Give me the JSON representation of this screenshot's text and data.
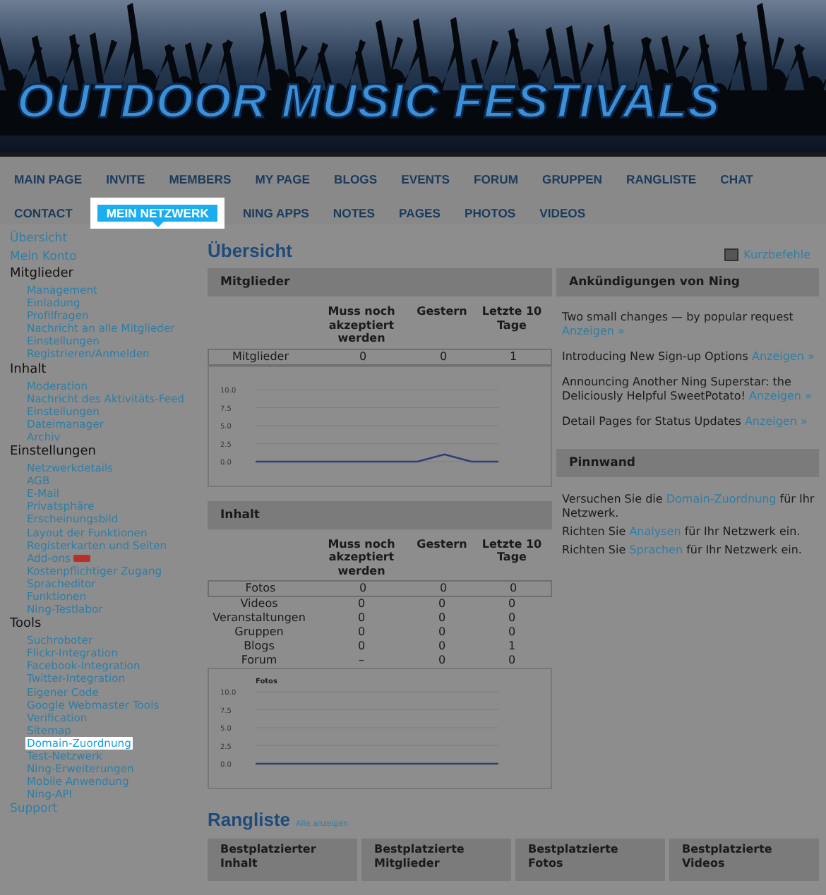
{
  "banner": {
    "title": "OUTDOOR MUSIC FESTIVALS"
  },
  "nav": {
    "tabs": [
      {
        "label": "MAIN PAGE",
        "selected": false
      },
      {
        "label": "INVITE",
        "selected": false
      },
      {
        "label": "MEMBERS",
        "selected": false
      },
      {
        "label": "MY PAGE",
        "selected": false
      },
      {
        "label": "BLOGS",
        "selected": false
      },
      {
        "label": "EVENTS",
        "selected": false
      },
      {
        "label": "FORUM",
        "selected": false
      },
      {
        "label": "GRUPPEN",
        "selected": false
      },
      {
        "label": "RANGLISTE",
        "selected": false
      },
      {
        "label": "CHAT",
        "selected": false
      },
      {
        "label": "CONTACT",
        "selected": false
      },
      {
        "label": "MEIN NETZWERK",
        "selected": true
      },
      {
        "label": "NING APPS",
        "selected": false
      },
      {
        "label": "NOTES",
        "selected": false
      },
      {
        "label": "PAGES",
        "selected": false
      },
      {
        "label": "PHOTOS",
        "selected": false
      },
      {
        "label": "VIDEOS",
        "selected": false
      }
    ]
  },
  "sidebar": {
    "items": [
      {
        "kind": "link",
        "label": "Übersicht"
      },
      {
        "kind": "link",
        "label": "Mein Konto"
      },
      {
        "kind": "section",
        "label": "Mitglieder",
        "children": [
          {
            "label": "Management",
            "selected": false,
            "new": false
          },
          {
            "label": "Einladung",
            "selected": false,
            "new": false
          },
          {
            "label": "Profilfragen",
            "selected": false,
            "new": false
          },
          {
            "label": "Nachricht an alle Mitglieder",
            "selected": false,
            "new": false
          },
          {
            "label": "Einstellungen",
            "selected": false,
            "new": false
          },
          {
            "label": "Registrieren/Anmelden",
            "selected": false,
            "new": false
          }
        ]
      },
      {
        "kind": "section",
        "label": "Inhalt",
        "children": [
          {
            "label": "Moderation",
            "selected": false,
            "new": false
          },
          {
            "label": "Nachricht des Aktivitäts-Feed",
            "selected": false,
            "new": false
          },
          {
            "label": "Einstellungen",
            "selected": false,
            "new": false
          },
          {
            "label": "Dateimanager",
            "selected": false,
            "new": false
          },
          {
            "label": "Archiv",
            "selected": false,
            "new": false
          }
        ]
      },
      {
        "kind": "section",
        "label": "Einstellungen",
        "children": [
          {
            "label": "Netzwerkdetails",
            "selected": false,
            "new": false
          },
          {
            "label": "AGB",
            "selected": false,
            "new": false
          },
          {
            "label": "E-Mail",
            "selected": false,
            "new": false
          },
          {
            "label": "Privatsphäre",
            "selected": false,
            "new": false
          },
          {
            "label": "Erscheinungsbild",
            "selected": false,
            "new": false
          },
          {
            "label": "Layout der Funktionen",
            "selected": false,
            "new": false
          },
          {
            "label": "Registerkarten und Seiten",
            "selected": false,
            "new": false
          },
          {
            "label": "Add-ons",
            "selected": false,
            "new": true
          },
          {
            "label": "Kostenpflichtiger Zugang",
            "selected": false,
            "new": false
          },
          {
            "label": "Spracheditor",
            "selected": false,
            "new": false
          },
          {
            "label": "Funktionen",
            "selected": false,
            "new": false
          },
          {
            "label": "Ning-Testlabor",
            "selected": false,
            "new": false
          }
        ]
      },
      {
        "kind": "section",
        "label": "Tools",
        "children": [
          {
            "label": "Suchroboter",
            "selected": false,
            "new": false
          },
          {
            "label": "Flickr-Integration",
            "selected": false,
            "new": false
          },
          {
            "label": "Facebook-Integration",
            "selected": false,
            "new": false
          },
          {
            "label": "Twitter-Integration",
            "selected": false,
            "new": false
          },
          {
            "label": "Eigener Code",
            "selected": false,
            "new": false
          },
          {
            "label": "Google Webmaster Tools",
            "selected": false,
            "new": false
          },
          {
            "label": "Verification",
            "selected": false,
            "new": false
          },
          {
            "label": "Sitemap",
            "selected": false,
            "new": false
          },
          {
            "label": "Domain-Zuordnung",
            "selected": true,
            "new": false
          },
          {
            "label": "Test-Netzwerk",
            "selected": false,
            "new": false
          },
          {
            "label": "Ning-Erweiterungen",
            "selected": false,
            "new": false
          },
          {
            "label": "Mobile Anwendung",
            "selected": false,
            "new": false
          },
          {
            "label": "Ning-API",
            "selected": false,
            "new": false
          }
        ]
      },
      {
        "kind": "link",
        "label": "Support"
      }
    ]
  },
  "overview": {
    "title": "Übersicht",
    "shortcuts": "Kurzbefehle"
  },
  "panels": [
    {
      "title": "Mitglieder",
      "columns": [
        "",
        "Muss noch akzeptiert werden",
        "Gestern",
        "Letzte 10 Tage"
      ],
      "rows": [
        [
          "Mitglieder",
          "0",
          "0",
          "1"
        ]
      ],
      "chart_data": {
        "type": "line",
        "grid": true,
        "ylim": [
          0,
          10
        ],
        "yticks": [
          {
            "value": 0,
            "label": "0.0"
          },
          {
            "value": 2.5,
            "label": "2.5"
          },
          {
            "value": 5,
            "label": "5.0"
          },
          {
            "value": 7.5,
            "label": "7.5"
          },
          {
            "value": 10,
            "label": "10.0"
          }
        ],
        "series": [
          {
            "color": "#2b3f78",
            "values": [
              0,
              0,
              0,
              0,
              0,
              0,
              0,
              1,
              0,
              0
            ]
          }
        ]
      }
    },
    {
      "title": "Inhalt",
      "columns": [
        "",
        "Muss noch akzeptiert werden",
        "Gestern",
        "Letzte 10 Tage"
      ],
      "rows": [
        [
          "Fotos",
          "0",
          "0",
          "0"
        ],
        [
          "Videos",
          "0",
          "0",
          "0"
        ],
        [
          "Veranstaltungen",
          "0",
          "0",
          "0"
        ],
        [
          "Gruppen",
          "0",
          "0",
          "0"
        ],
        [
          "Blogs",
          "0",
          "0",
          "1"
        ],
        [
          "Forum",
          "–",
          "0",
          "0"
        ]
      ],
      "chart_data": {
        "type": "line",
        "grid": true,
        "ylim": [
          0,
          10
        ],
        "yticks": [
          {
            "value": 0,
            "label": "0.0"
          },
          {
            "value": 2.5,
            "label": "2.5"
          },
          {
            "value": 5,
            "label": "5.0"
          },
          {
            "value": 7.5,
            "label": "7.5"
          },
          {
            "value": 10,
            "label": "10.0"
          }
        ],
        "series": [
          {
            "name": "Fotos",
            "color": "#2b3f78",
            "values": [
              0,
              0,
              0,
              0,
              0,
              0,
              0,
              0,
              0,
              0
            ]
          }
        ]
      }
    }
  ],
  "announcements": {
    "title": "Ankündigungen von Ning",
    "items": [
      {
        "text": "Two small changes — by popular request",
        "link": "Anzeigen »"
      },
      {
        "text": "Introducing New Sign-up Options",
        "link": "Anzeigen »"
      },
      {
        "text": "Announcing Another Ning Superstar: the Deliciously Helpful SweetPotato!",
        "link": "Anzeigen »"
      },
      {
        "text": "Detail Pages for Status Updates",
        "link": "Anzeigen »"
      }
    ]
  },
  "pinnwand": {
    "title": "Pinnwand",
    "items": [
      {
        "before": "Versuchen Sie die",
        "link": "Domain-Zuordnung",
        "after": "für Ihr Netzwerk."
      },
      {
        "before": "Richten Sie",
        "link": "Analysen",
        "after": "für Ihr Netzwerk ein."
      },
      {
        "before": "Richten Sie",
        "link": "Sprachen",
        "after": "für Ihr Netzwerk ein."
      }
    ]
  },
  "rangliste": {
    "title": "Rangliste",
    "link": "Alle anzeigen",
    "columns": [
      "Bestplatzierter Inhalt",
      "Bestplatzierte Mitglieder",
      "Bestplatzierte Fotos",
      "Bestplatzierte Videos"
    ]
  }
}
